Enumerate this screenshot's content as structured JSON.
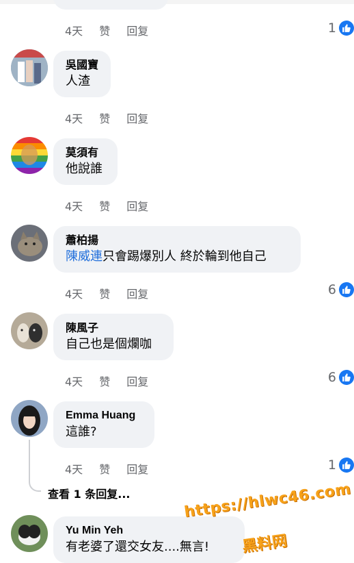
{
  "comments": [
    {
      "author": "",
      "text": "",
      "time": "4天",
      "like": "赞",
      "reply": "回复",
      "reactions": "1"
    },
    {
      "author": "吳國寶",
      "text": "人渣",
      "time": "4天",
      "like": "赞",
      "reply": "回复",
      "reactions": ""
    },
    {
      "author": "莫須有",
      "text": "他說誰",
      "time": "4天",
      "like": "赞",
      "reply": "回复",
      "reactions": ""
    },
    {
      "author": "蕭柏揚",
      "mention": "陳威連",
      "text": "只會踢爆別人 終於輪到他自己",
      "time": "4天",
      "like": "赞",
      "reply": "回复",
      "reactions": "6"
    },
    {
      "author": "陳風子",
      "text": "自己也是個爛咖",
      "time": "4天",
      "like": "赞",
      "reply": "回复",
      "reactions": "6"
    },
    {
      "author": "Emma Huang",
      "text": "這誰?",
      "time": "4天",
      "like": "赞",
      "reply": "回复",
      "reactions": "1"
    },
    {
      "author": "Yu Min Yeh",
      "text": "有老婆了還交女友....無言!",
      "time": "",
      "like": "",
      "reply": "",
      "reactions": ""
    }
  ],
  "view_replies": "查看 1 条回复...",
  "watermark": {
    "url": "https://hlwc46.com",
    "name": "黑料网"
  },
  "colors": {
    "bubble": "#f0f2f5",
    "meta": "#65676b",
    "mention": "#216fdb",
    "like_blue": "#1877f2",
    "watermark": "#f7a21a"
  }
}
